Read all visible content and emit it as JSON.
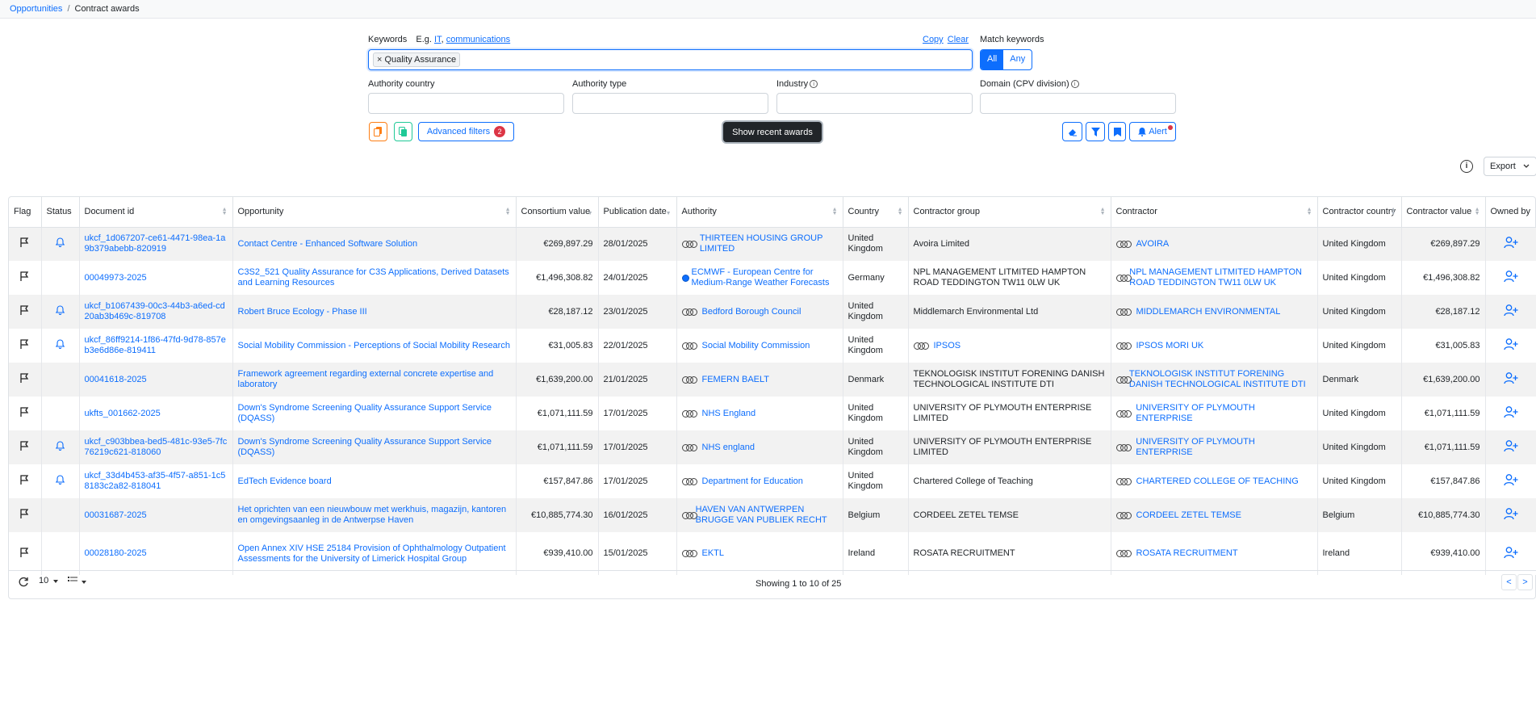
{
  "breadcrumb": {
    "parent": "Opportunities",
    "separator": "/",
    "current": "Contract awards"
  },
  "filters": {
    "keywords_label": "Keywords",
    "example_prefix": "E.g.",
    "examples": [
      "IT",
      "communications"
    ],
    "example_comma": ",",
    "copy_label": "Copy",
    "clear_label": "Clear",
    "chip_remove": "×",
    "chip": "Quality Assurance",
    "match_label": "Match keywords",
    "match_all": "All",
    "match_any": "Any",
    "authority_country": "Authority country",
    "authority_type": "Authority type",
    "industry": "Industry",
    "domain": "Domain (CPV division)",
    "info_glyph": "i",
    "advanced_label": "Advanced filters",
    "advanced_count": "2",
    "show_recent": "Show recent awards",
    "alert_label": "Alert"
  },
  "toolbar": {
    "info_glyph": "i",
    "export_label": "Export"
  },
  "columns": [
    "Flag",
    "Status",
    "Document id",
    "Opportunity",
    "Consortium value",
    "Publication date",
    "Authority",
    "Country",
    "Contractor group",
    "Contractor",
    "Contractor country",
    "Contractor value",
    "Owned by"
  ],
  "rows": [
    {
      "bell": true,
      "doc": "ukcf_1d067207-ce61-4471-98ea-1a9b379abebb-820919",
      "opp": "Contact Centre - Enhanced Software Solution",
      "cons": "€269,897.29",
      "pub": "28/01/2025",
      "auth": "THIRTEEN HOUSING GROUP LIMITED",
      "auth_icon": "org",
      "country": "United Kingdom",
      "cgroup": "Avoira Limited",
      "cgroup_icon": false,
      "contractor": "AVOIRA",
      "ccountry": "United Kingdom",
      "cval": "€269,897.29"
    },
    {
      "bell": false,
      "doc": "00049973-2025",
      "opp": "C3S2_521 Quality Assurance for C3S Applications, Derived Datasets and Learning Resources",
      "cons": "€1,496,308.82",
      "pub": "24/01/2025",
      "auth": "ECMWF - European Centre for Medium-Range Weather Forecasts",
      "auth_icon": "dot",
      "country": "Germany",
      "cgroup": "NPL MANAGEMENT LITMITED HAMPTON ROAD TEDDINGTON TW11 0LW UK",
      "cgroup_icon": false,
      "contractor": "NPL MANAGEMENT LITMITED HAMPTON ROAD TEDDINGTON TW11 0LW UK",
      "ccountry": "United Kingdom",
      "cval": "€1,496,308.82"
    },
    {
      "bell": true,
      "doc": "ukcf_b1067439-00c3-44b3-a6ed-cd20ab3b469c-819708",
      "opp": "Robert Bruce Ecology - Phase III",
      "cons": "€28,187.12",
      "pub": "23/01/2025",
      "auth": "Bedford Borough Council",
      "auth_icon": "org",
      "country": "United Kingdom",
      "cgroup": "Middlemarch Environmental Ltd",
      "cgroup_icon": false,
      "contractor": "MIDDLEMARCH ENVIRONMENTAL",
      "ccountry": "United Kingdom",
      "cval": "€28,187.12"
    },
    {
      "bell": true,
      "doc": "ukcf_86ff9214-1f86-47fd-9d78-857eb3e6d86e-819411",
      "opp": "Social Mobility Commission - Perceptions of Social Mobility Research",
      "cons": "€31,005.83",
      "pub": "22/01/2025",
      "auth": "Social Mobility Commission",
      "auth_icon": "org",
      "country": "United Kingdom",
      "cgroup": "IPSOS",
      "cgroup_icon": true,
      "contractor": "IPSOS MORI UK",
      "ccountry": "United Kingdom",
      "cval": "€31,005.83"
    },
    {
      "bell": false,
      "doc": "00041618-2025",
      "opp": "Framework agreement regarding external concrete expertise and laboratory",
      "cons": "€1,639,200.00",
      "pub": "21/01/2025",
      "auth": "FEMERN BAELT",
      "auth_icon": "org",
      "country": "Denmark",
      "cgroup": "TEKNOLOGISK INSTITUT FORENING DANISH TECHNOLOGICAL INSTITUTE DTI",
      "cgroup_icon": false,
      "contractor": "TEKNOLOGISK INSTITUT FORENING DANISH TECHNOLOGICAL INSTITUTE DTI",
      "ccountry": "Denmark",
      "cval": "€1,639,200.00"
    },
    {
      "bell": false,
      "doc": "ukfts_001662-2025",
      "opp": "Down's Syndrome Screening Quality Assurance Support Service (DQASS)",
      "cons": "€1,071,111.59",
      "pub": "17/01/2025",
      "auth": "NHS England",
      "auth_icon": "org",
      "country": "United Kingdom",
      "cgroup": "UNIVERSITY OF PLYMOUTH ENTERPRISE LIMITED",
      "cgroup_icon": false,
      "contractor": "UNIVERSITY OF PLYMOUTH ENTERPRISE",
      "ccountry": "United Kingdom",
      "cval": "€1,071,111.59"
    },
    {
      "bell": true,
      "doc": "ukcf_c903bbea-bed5-481c-93e5-7fc76219c621-818060",
      "opp": "Down's Syndrome Screening Quality Assurance Support Service (DQASS)",
      "cons": "€1,071,111.59",
      "pub": "17/01/2025",
      "auth": "NHS england",
      "auth_icon": "org",
      "country": "United Kingdom",
      "cgroup": "UNIVERSITY OF PLYMOUTH ENTERPRISE LIMITED",
      "cgroup_icon": false,
      "contractor": "UNIVERSITY OF PLYMOUTH ENTERPRISE",
      "ccountry": "United Kingdom",
      "cval": "€1,071,111.59"
    },
    {
      "bell": true,
      "doc": "ukcf_33d4b453-af35-4f57-a851-1c58183c2a82-818041",
      "opp": "EdTech Evidence board",
      "cons": "€157,847.86",
      "pub": "17/01/2025",
      "auth": "Department for Education",
      "auth_icon": "org",
      "country": "United Kingdom",
      "cgroup": "Chartered College of Teaching",
      "cgroup_icon": false,
      "contractor": "CHARTERED COLLEGE OF TEACHING",
      "ccountry": "United Kingdom",
      "cval": "€157,847.86"
    },
    {
      "bell": false,
      "doc": "00031687-2025",
      "opp": "Het oprichten van een nieuwbouw met werkhuis, magazijn, kantoren en omgevingsaanleg in de Antwerpse Haven",
      "cons": "€10,885,774.30",
      "pub": "16/01/2025",
      "auth": "HAVEN VAN ANTWERPEN BRUGGE VAN PUBLIEK RECHT",
      "auth_icon": "org",
      "country": "Belgium",
      "cgroup": "CORDEEL ZETEL TEMSE",
      "cgroup_icon": false,
      "contractor": "CORDEEL ZETEL TEMSE",
      "ccountry": "Belgium",
      "cval": "€10,885,774.30"
    },
    {
      "bell": false,
      "doc": "00028180-2025",
      "opp": "Open Annex XIV HSE 25184 Provision of Ophthalmology Outpatient Assessments for the University of Limerick Hospital Group",
      "cons": "€939,410.00",
      "pub": "15/01/2025",
      "auth": "EKTL",
      "auth_icon": "org",
      "country": "Ireland",
      "cgroup": "ROSATA RECRUITMENT",
      "cgroup_icon": false,
      "contractor": "ROSATA RECRUITMENT",
      "ccountry": "Ireland",
      "cval": "€939,410.00"
    }
  ],
  "footer": {
    "page_size": "10",
    "showing": "Showing 1 to 10 of 25",
    "prev": "<",
    "next": ">"
  }
}
